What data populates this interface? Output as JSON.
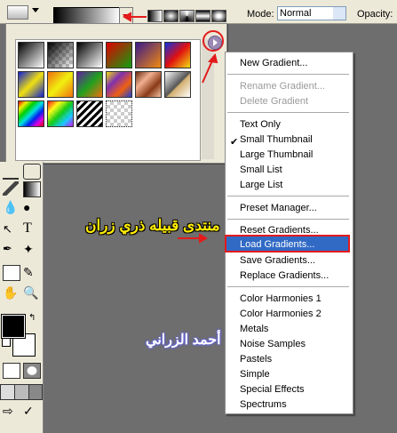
{
  "options_bar": {
    "mode_label": "Mode:",
    "mode_value": "Normal",
    "opacity_label": "Opacity:"
  },
  "gradient_picker": {
    "swatches": [
      "foreground-to-background",
      "foreground-to-transparent",
      "black-white",
      "red-green",
      "violet-orange",
      "blue-red-yellow",
      "blue-yellow-blue",
      "orange-yellow-orange",
      "violet-green-orange",
      "yellow-violet-orange-blue",
      "copper",
      "chrome",
      "spectrum",
      "transparent-rainbow",
      "transparent-stripes"
    ]
  },
  "menu": {
    "items": [
      {
        "label": "New Gradient...",
        "state": "enabled"
      },
      {
        "label": "Rename Gradient...",
        "state": "disabled"
      },
      {
        "label": "Delete Gradient",
        "state": "disabled"
      },
      {
        "label": "Text Only",
        "state": "enabled"
      },
      {
        "label": "Small Thumbnail",
        "state": "checked"
      },
      {
        "label": "Large Thumbnail",
        "state": "enabled"
      },
      {
        "label": "Small List",
        "state": "enabled"
      },
      {
        "label": "Large List",
        "state": "enabled"
      },
      {
        "label": "Preset Manager...",
        "state": "enabled"
      },
      {
        "label": "Reset Gradients...",
        "state": "enabled"
      },
      {
        "label": "Load Gradients...",
        "state": "highlighted"
      },
      {
        "label": "Save Gradients...",
        "state": "enabled"
      },
      {
        "label": "Replace Gradients...",
        "state": "enabled"
      },
      {
        "label": "Color Harmonies 1",
        "state": "enabled"
      },
      {
        "label": "Color Harmonies 2",
        "state": "enabled"
      },
      {
        "label": "Metals",
        "state": "enabled"
      },
      {
        "label": "Noise Samples",
        "state": "enabled"
      },
      {
        "label": "Pastels",
        "state": "enabled"
      },
      {
        "label": "Simple",
        "state": "enabled"
      },
      {
        "label": "Special Effects",
        "state": "enabled"
      },
      {
        "label": "Spectrums",
        "state": "enabled"
      }
    ],
    "checkmark": "✔"
  },
  "annotations": {
    "forum_text": "منتدى قبيله ذري زران",
    "author_text": "أحمد الزراني",
    "arrow_color": "#e31b1b"
  },
  "colors": {
    "highlight": "#316ac5",
    "workspace": "#6e6e6e",
    "panel": "#ece9d8"
  }
}
